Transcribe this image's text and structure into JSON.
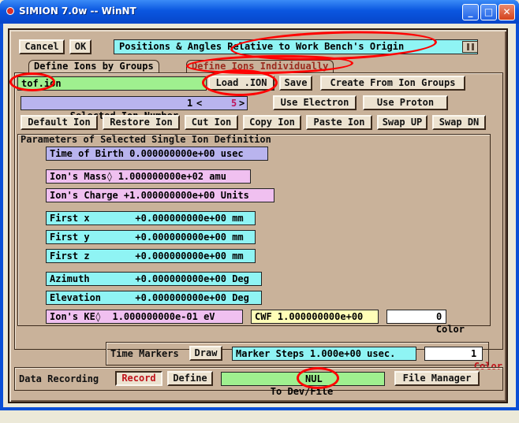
{
  "window": {
    "title": "SIMION 7.0w -- WinNT",
    "minimize_glyph": "_",
    "maximize_glyph": "□",
    "close_glyph": "✕"
  },
  "toolbar": {
    "cancel_label": "Cancel",
    "ok_label": "OK",
    "mode_value": "Positions & Angles Relative to Work Bench's Origin"
  },
  "tabs": [
    {
      "label": "Define Ions by Groups",
      "active": false
    },
    {
      "label": "Define Ions Individually",
      "active": true
    }
  ],
  "file_row": {
    "filename": "tof.ion",
    "load_label": "Load .ION",
    "save_label": "Save",
    "create_label": "Create From Ion Groups"
  },
  "selection": {
    "label": "Selected Ion Number",
    "current": "1",
    "of_total": "5",
    "use_electron_label": "Use Electron",
    "use_proton_label": "Use Proton"
  },
  "actions": [
    "Default Ion",
    "Restore Ion",
    "Cut Ion",
    "Copy Ion",
    "Paste Ion",
    "Swap UP",
    "Swap DN"
  ],
  "params": {
    "heading": "Parameters of Selected Single Ion Definition",
    "time_of_birth": "Time of Birth 0.000000000e+00 usec",
    "mass": "Ion's Mass◊ 1.000000000e+02 amu",
    "charge": "Ion's Charge +1.000000000e+00 Units",
    "first_x": "First x        +0.000000000e+00 mm",
    "first_y": "First y        +0.000000000e+00 mm",
    "first_z": "First z        +0.000000000e+00 mm",
    "azimuth": "Azimuth        +0.000000000e+00 Deg",
    "elevation": "Elevation      +0.000000000e+00 Deg",
    "ke": "Ion's KE◊  1.000000000e-01 eV",
    "cwf": "CWF 1.000000000e+00",
    "color_label": "Color",
    "color_value": "0"
  },
  "time_markers": {
    "label": "Time Markers",
    "draw_label": "Draw",
    "steps": "Marker Steps 1.000e+00 usec.",
    "color_label": "Color",
    "color_value": "1"
  },
  "data_recording": {
    "label": "Data Recording",
    "record_label": "Record",
    "define_label": "Define",
    "dev_file_label": "To Dev/File",
    "dev_file_value": "NUL",
    "file_manager_label": "File Manager"
  },
  "colors": {
    "frame": "#c9b29a",
    "field_cyan": "#8ff4f4",
    "field_lavender": "#b9b4ee",
    "field_pink": "#f0c0f0",
    "field_green": "#9ff08f",
    "annotation": "#ff0000"
  }
}
